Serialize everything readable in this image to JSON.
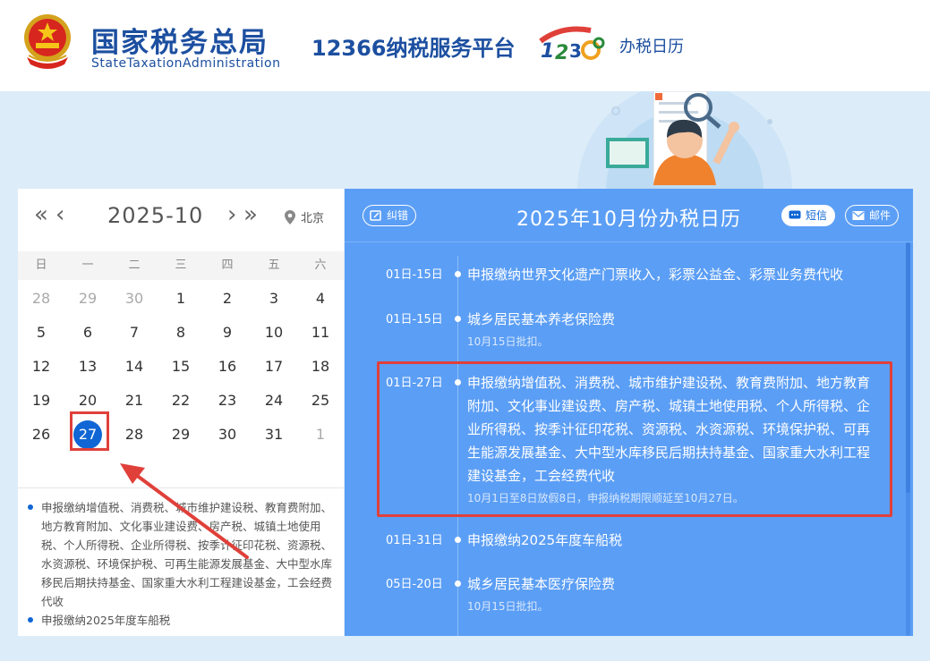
{
  "header": {
    "org_cn": "国家税务总局",
    "org_en": "StateTaxationAdministration",
    "platform": "12366纳税服务平台",
    "page_name": "办税日历"
  },
  "calendar": {
    "month": "2025-10",
    "location": "北京",
    "weekdays": [
      "日",
      "一",
      "二",
      "三",
      "四",
      "五",
      "六"
    ],
    "weeks": [
      [
        "28",
        "29",
        "30",
        "1",
        "2",
        "3",
        "4"
      ],
      [
        "5",
        "6",
        "7",
        "8",
        "9",
        "10",
        "11"
      ],
      [
        "12",
        "13",
        "14",
        "15",
        "16",
        "17",
        "18"
      ],
      [
        "19",
        "20",
        "21",
        "22",
        "23",
        "24",
        "25"
      ],
      [
        "26",
        "27",
        "28",
        "29",
        "30",
        "31",
        "1"
      ]
    ],
    "selected_day": "27",
    "notes": [
      "申报缴纳增值税、消费税、城市维护建设税、教育费附加、地方教育附加、文化事业建设费、房产税、城镇土地使用税、个人所得税、企业所得税、按季计征印花税、资源税、水资源税、环境保护税、可再生能源发展基金、大中型水库移民后期扶持基金、国家重大水利工程建设基金，工会经费代收",
      "申报缴纳2025年度车船税"
    ]
  },
  "panel": {
    "title": "2025年10月份办税日历",
    "btn_error": "纠错",
    "btn_sms": "短信",
    "btn_mail": "邮件",
    "events": [
      {
        "date": "01日-15日",
        "title": "申报缴纳世界文化遗产门票收入，彩票公益金、彩票业务费代收",
        "note": ""
      },
      {
        "date": "01日-15日",
        "title": "城乡居民基本养老保险费",
        "note": "10月15日批扣。"
      },
      {
        "date": "01日-27日",
        "title": "申报缴纳增值税、消费税、城市维护建设税、教育费附加、地方教育附加、文化事业建设费、房产税、城镇土地使用税、个人所得税、企业所得税、按季计征印花税、资源税、水资源税、环境保护税、可再生能源发展基金、大中型水库移民后期扶持基金、国家重大水利工程建设基金，工会经费代收",
        "note": "10月1日至8日放假8日，申报纳税期限顺延至10月27日。"
      },
      {
        "date": "01日-31日",
        "title": "申报缴纳2025年度车船税",
        "note": ""
      },
      {
        "date": "05日-20日",
        "title": "城乡居民基本医疗保险费",
        "note": "10月15日批扣。"
      }
    ]
  },
  "colors": {
    "brand": "#1c4fa0",
    "panel_blue": "#5b9ef5",
    "selected": "#1066d4",
    "highlight": "#e0403a"
  }
}
